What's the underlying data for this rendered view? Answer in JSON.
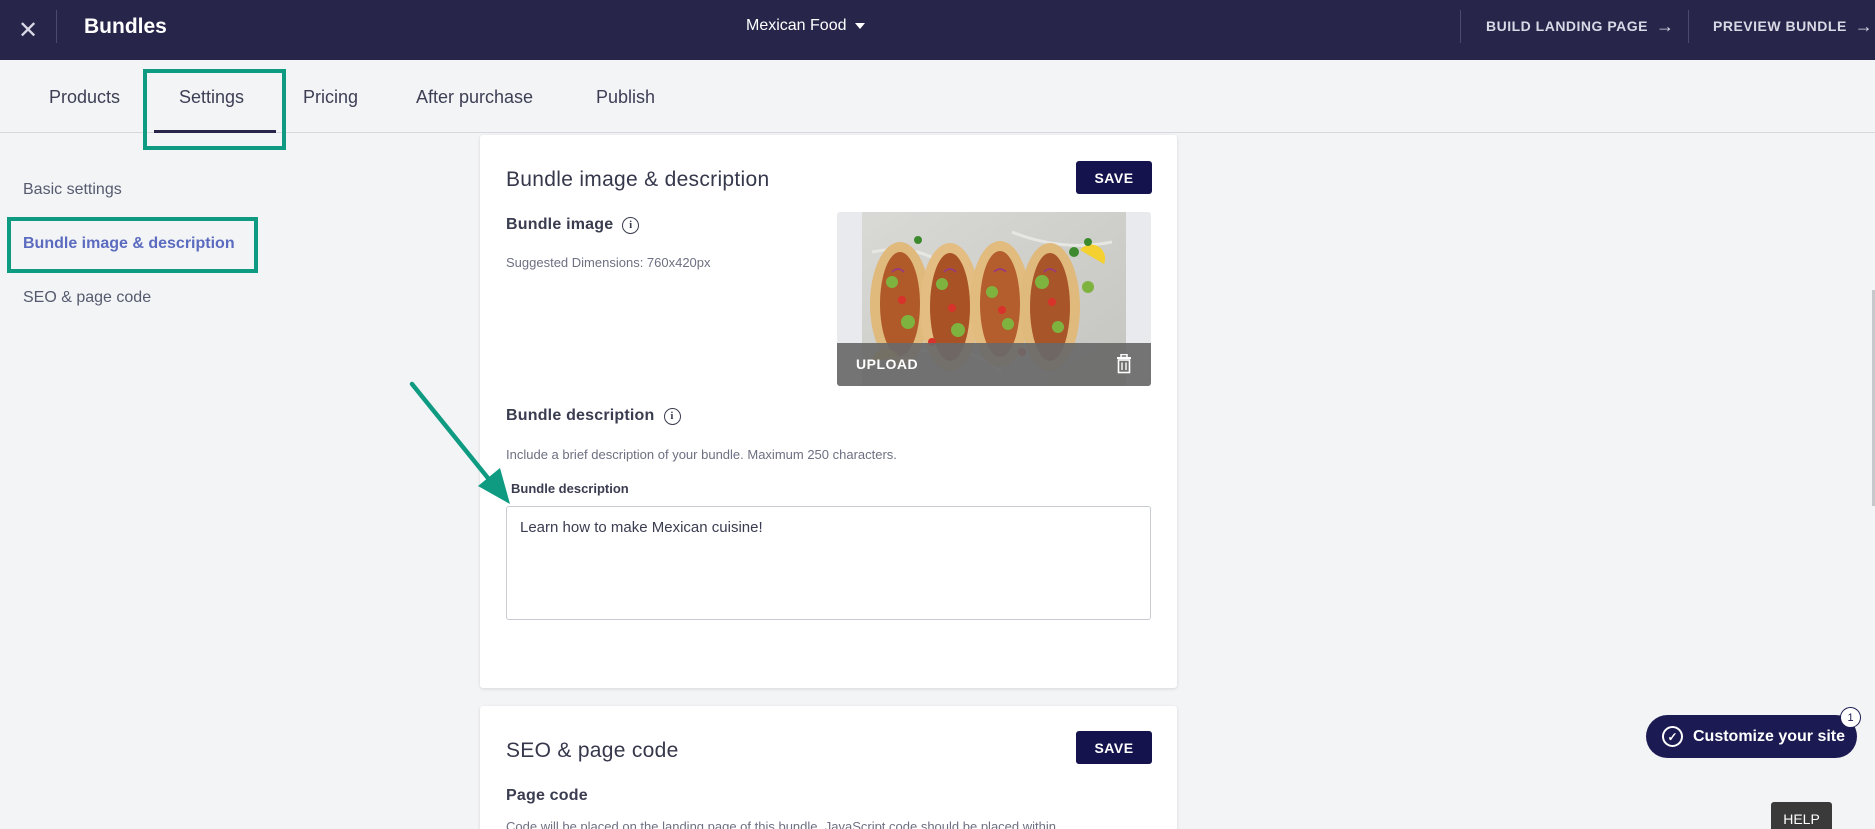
{
  "header": {
    "close_icon": "close-icon",
    "title": "Bundles",
    "bundle_name": "Mexican Food",
    "build_landing_page": "BUILD LANDING PAGE",
    "preview_bundle": "PREVIEW BUNDLE"
  },
  "tabs": [
    {
      "label": "Products"
    },
    {
      "label": "Settings",
      "active": true
    },
    {
      "label": "Pricing"
    },
    {
      "label": "After purchase"
    },
    {
      "label": "Publish"
    }
  ],
  "sidenav": {
    "items": [
      {
        "label": "Basic settings"
      },
      {
        "label": "Bundle image & description",
        "active": true
      },
      {
        "label": "SEO & page code"
      }
    ]
  },
  "image_card": {
    "title": "Bundle image & description",
    "save_label": "SAVE",
    "image_label": "Bundle image",
    "image_hint": "Suggested Dimensions: 760x420px",
    "upload_label": "UPLOAD",
    "description_label": "Bundle description",
    "description_hint": "Include a brief description of your bundle. Maximum 250 characters.",
    "field_label": "Bundle description",
    "field_value": "Learn how to make Mexican cuisine!"
  },
  "seo_card": {
    "title": "SEO & page code",
    "save_label": "SAVE",
    "page_code_label": "Page code",
    "page_code_hint": "Code will be placed on the landing page of this bundle. JavaScript code should be placed within"
  },
  "customize": {
    "label": "Customize your site",
    "badge_count": "1"
  },
  "help_label": "HELP",
  "colors": {
    "header_bg": "#27264a",
    "primary_button": "#15134d",
    "highlight": "#0f9b82",
    "active_link": "#5b6bbf"
  }
}
